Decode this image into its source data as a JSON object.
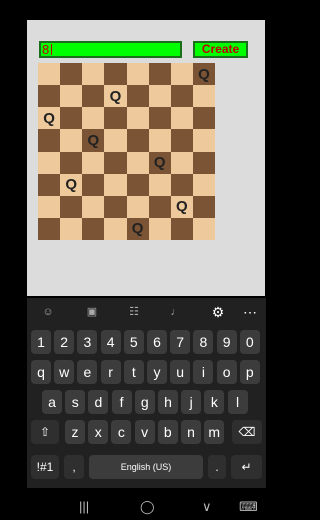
{
  "app": {
    "size_value": "8",
    "create_label": "Create",
    "board": [
      [
        "",
        "",
        "",
        "",
        "",
        "",
        "",
        "Q"
      ],
      [
        "",
        "",
        "",
        "Q",
        "",
        "",
        "",
        ""
      ],
      [
        "Q",
        "",
        "",
        "",
        "",
        "",
        "",
        ""
      ],
      [
        "",
        "",
        "Q",
        "",
        "",
        "",
        "",
        ""
      ],
      [
        "",
        "",
        "",
        "",
        "",
        "Q",
        "",
        ""
      ],
      [
        "",
        "Q",
        "",
        "",
        "",
        "",
        "",
        ""
      ],
      [
        "",
        "",
        "",
        "",
        "",
        "",
        "Q",
        ""
      ],
      [
        "",
        "",
        "",
        "",
        "Q",
        "",
        "",
        ""
      ]
    ]
  },
  "keyboard": {
    "toolbar_icons": [
      "emoji-icon",
      "sticker-icon",
      "clipboard-icon",
      "mic-icon",
      "gear-icon",
      "more-icon"
    ],
    "row1": [
      "1",
      "2",
      "3",
      "4",
      "5",
      "6",
      "7",
      "8",
      "9",
      "0"
    ],
    "row2": [
      "q",
      "w",
      "e",
      "r",
      "t",
      "y",
      "u",
      "i",
      "o",
      "p"
    ],
    "row3": [
      "a",
      "s",
      "d",
      "f",
      "g",
      "h",
      "j",
      "k",
      "l"
    ],
    "row4": [
      "z",
      "x",
      "c",
      "v",
      "b",
      "n",
      "m"
    ],
    "symbols_label": "!#1",
    "comma_label": ",",
    "space_label": "English (US)",
    "period_label": ".",
    "shift_icon": "shift-icon",
    "backspace_icon": "backspace-icon",
    "enter_icon": "enter-icon"
  },
  "navbar": {
    "icons": [
      "recents-icon",
      "home-icon",
      "back-icon",
      "keyboard-icon"
    ]
  }
}
